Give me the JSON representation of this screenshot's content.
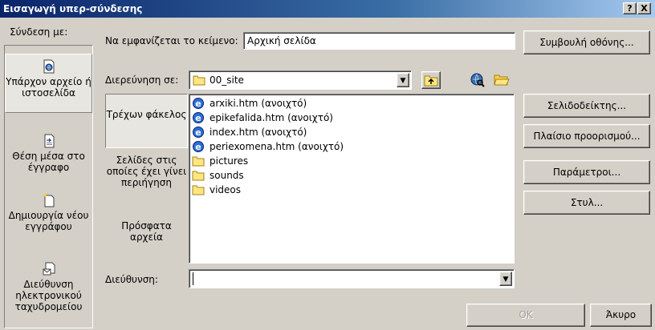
{
  "window": {
    "title": "Εισαγωγή υπερ-σύνδεσης",
    "help_button": "?",
    "close_button": "X"
  },
  "link_to": {
    "label": "Σύνδεση με:",
    "items": [
      {
        "label": "Υπάρχον αρχείο ή ιστοσελίδα",
        "icon": "existing-file-icon",
        "active": true
      },
      {
        "label": "Θέση μέσα στο έγγραφο",
        "icon": "place-in-document-icon",
        "active": false
      },
      {
        "label": "Δημιουργία νέου εγγράφου",
        "icon": "new-document-icon",
        "active": false
      },
      {
        "label": "Διεύθυνση ηλεκτρονικού ταχυδρομείου",
        "icon": "email-address-icon",
        "active": false
      }
    ]
  },
  "text_to_display": {
    "label": "Να εμφανίζεται το κείμενο:",
    "value": "Αρχική σελίδα"
  },
  "screen_tip_button": "Συμβουλή οθόνης...",
  "look_in": {
    "label": "Διερεύνηση σε:",
    "value": "00_site"
  },
  "nav": {
    "items": [
      {
        "label": "Τρέχων φάκελος",
        "active": true
      },
      {
        "label": "Σελίδες στις οποίες έχει γίνει περιήγηση",
        "active": false
      },
      {
        "label": "Πρόσφατα αρχεία",
        "active": false
      }
    ]
  },
  "files": [
    {
      "name": "arxiki.htm (ανοιχτό)",
      "icon": "web-page-icon"
    },
    {
      "name": "epikefalida.htm (ανοιχτό)",
      "icon": "web-page-icon"
    },
    {
      "name": "index.htm (ανοιχτό)",
      "icon": "web-page-icon"
    },
    {
      "name": "periexomena.htm (ανοιχτό)",
      "icon": "web-page-icon"
    },
    {
      "name": "pictures",
      "icon": "folder-icon"
    },
    {
      "name": "sounds",
      "icon": "folder-icon"
    },
    {
      "name": "videos",
      "icon": "folder-icon"
    }
  ],
  "side_buttons": {
    "bookmark": "Σελιδοδείκτης...",
    "target_frame": "Πλαίσιο προορισμού...",
    "parameters": "Παράμετροι...",
    "style": "Στυλ..."
  },
  "address": {
    "label": "Διεύθυνση:",
    "value": ""
  },
  "footer": {
    "ok": "OK",
    "cancel": "Άκυρο"
  },
  "colors": {
    "titlebar_start": "#0a246a",
    "titlebar_end": "#a6caf0",
    "dialog_face": "#d4d0c8"
  }
}
